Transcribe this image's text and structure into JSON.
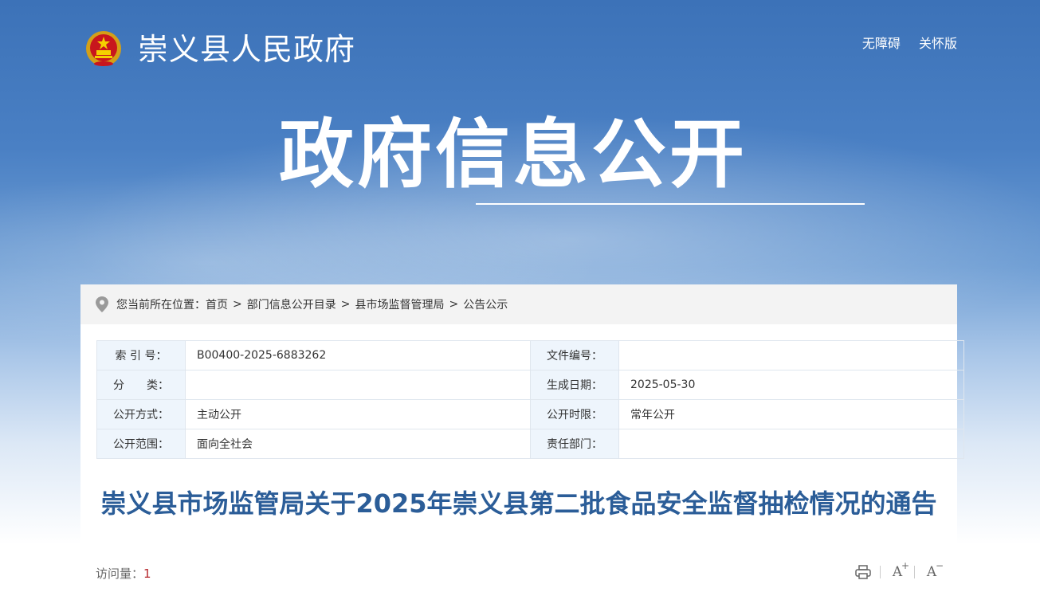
{
  "header": {
    "site_title": "崇义县人民政府",
    "links": [
      "无障碍",
      "关怀版"
    ]
  },
  "banner": {
    "title": "政府信息公开"
  },
  "breadcrumb": {
    "prefix": "您当前所在位置：",
    "items": [
      "首页",
      "部门信息公开目录",
      "县市场监督管理局",
      "公告公示"
    ],
    "separator": ">"
  },
  "meta": {
    "rows": [
      {
        "l1": "索 引 号：",
        "v1": "B00400-2025-6883262",
        "l2": "文件编号：",
        "v2": ""
      },
      {
        "l1": "分　　类：",
        "v1": "",
        "l2": "生成日期：",
        "v2": "2025-05-30"
      },
      {
        "l1": "公开方式：",
        "v1": "主动公开",
        "l2": "公开时限：",
        "v2": "常年公开"
      },
      {
        "l1": "公开范围：",
        "v1": "面向全社会",
        "l2": "责任部门：",
        "v2": ""
      }
    ]
  },
  "document": {
    "title": "崇义县市场监管局关于2025年崇义县第二批食品安全监督抽检情况的通告",
    "visits_label": "访问量：",
    "visits_count": "1"
  },
  "colors": {
    "title_blue": "#2b5d98",
    "count_red": "#b5262b"
  },
  "icons": [
    "emblem-icon",
    "location-pin-icon",
    "print-icon",
    "font-increase-icon",
    "font-decrease-icon"
  ]
}
